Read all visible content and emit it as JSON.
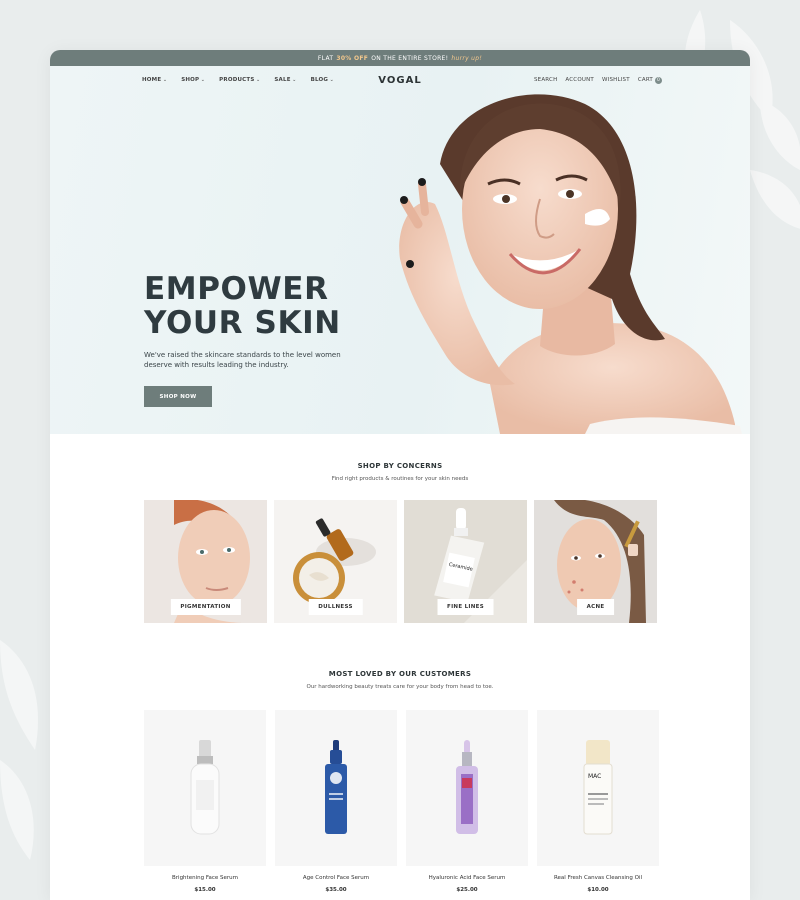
{
  "announcement": {
    "prefix": "FLAT",
    "highlight": "30% OFF",
    "middle": "ON THE ENTIRE STORE!",
    "hurry": "hurry up!"
  },
  "nav": {
    "items": [
      {
        "label": "HOME"
      },
      {
        "label": "SHOP"
      },
      {
        "label": "PRODUCTS"
      },
      {
        "label": "SALE"
      },
      {
        "label": "BLOG"
      }
    ],
    "logo": "VOGAL",
    "right": {
      "search": "SEARCH",
      "account": "ACCOUNT",
      "wishlist": "WISHLIST",
      "cart": "CART",
      "cart_count": "0"
    }
  },
  "hero": {
    "title": "EMPOWER\nYOUR SKIN",
    "subtitle": "We've raised the skincare standards to the level women deserve with results leading the industry.",
    "button": "SHOP NOW"
  },
  "concerns": {
    "title": "SHOP BY CONCERNS",
    "subtitle": "Find right products & routines for your skin needs",
    "items": [
      {
        "label": "PIGMENTATION"
      },
      {
        "label": "DULLNESS"
      },
      {
        "label": "FINE LINES"
      },
      {
        "label": "ACNE"
      }
    ]
  },
  "loved": {
    "title": "MOST LOVED BY OUR CUSTOMERS",
    "subtitle": "Our hardworking beauty treats care for your body from head to toe.",
    "products": [
      {
        "name": "Brightening Face Serum",
        "price": "$15.00"
      },
      {
        "name": "Age Control Face Serum",
        "price": "$35.00"
      },
      {
        "name": "Hyaluronic Acid Face Serum",
        "price": "$25.00"
      },
      {
        "name": "Real Fresh Canvas Cleansing Oil",
        "price": "$10.00"
      }
    ]
  },
  "colors": {
    "accent": "#6e7d7b",
    "announcement_highlight": "#f3c88d",
    "hero_bg": "#e8f2f3",
    "heading": "#2f3b40"
  }
}
